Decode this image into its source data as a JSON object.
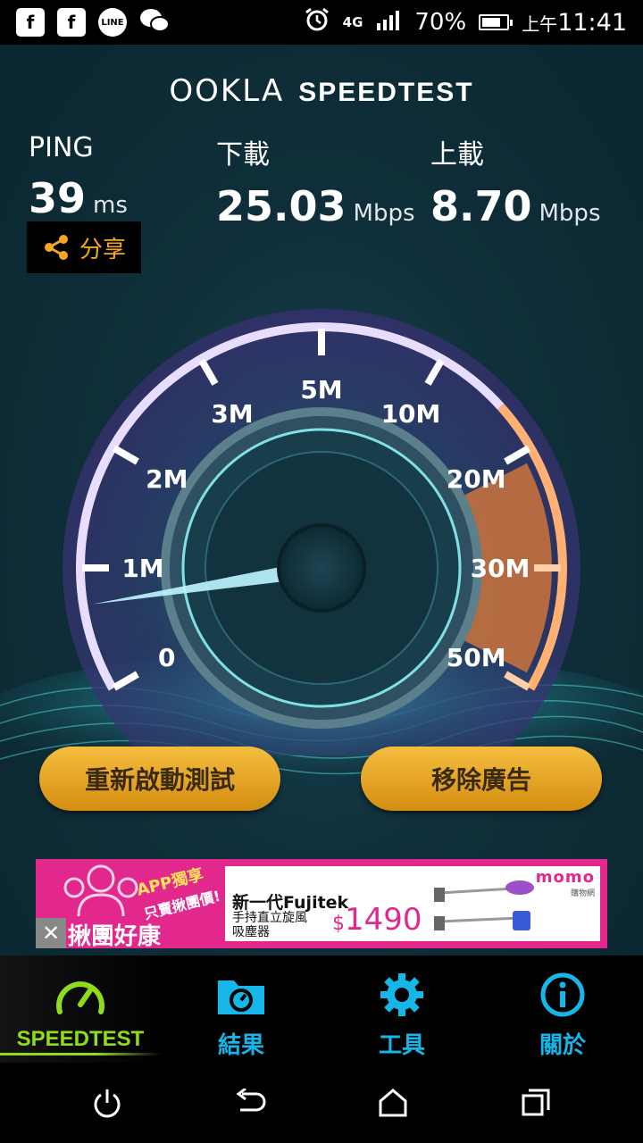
{
  "status_bar": {
    "apps": [
      "facebook-icon",
      "facebook-icon",
      "line-icon",
      "wechat-icon"
    ],
    "line_text": "LINE",
    "network": "4G",
    "battery": "70%",
    "time_prefix": "上午",
    "time": "11:41"
  },
  "header": {
    "brand": "OOKLA",
    "product": "SPEEDTEST"
  },
  "stats": {
    "ping": {
      "label": "PING",
      "value": "39",
      "unit": "ms"
    },
    "download": {
      "label": "下載",
      "value": "25.03",
      "unit": "Mbps"
    },
    "upload": {
      "label": "上載",
      "value": "8.70",
      "unit": "Mbps"
    }
  },
  "share": {
    "label": "分享",
    "icon": "share-icon"
  },
  "gauge": {
    "ticks": [
      "0",
      "1M",
      "2M",
      "3M",
      "5M",
      "10M",
      "20M",
      "30M",
      "50M"
    ],
    "needle_reading": 0.35,
    "colors": {
      "ring": "#c9b6ff",
      "active": "#ff9a3c"
    }
  },
  "buttons": {
    "restart": "重新啟動測試",
    "remove_ads": "移除廣告"
  },
  "ad": {
    "brand": "揪團好康",
    "app_tag": "APP獨享",
    "app_sub": "只賣揪團價!",
    "store": "momo",
    "store_sub": "購物網",
    "title": "新一代Fujitek",
    "desc": "手持直立旋風吸塵器",
    "currency": "$",
    "price": "1490",
    "close": "✕"
  },
  "tabs": [
    {
      "label": "SPEEDTEST",
      "icon": "speedometer-icon",
      "active": true
    },
    {
      "label": "結果",
      "icon": "results-folder-icon",
      "active": false
    },
    {
      "label": "工具",
      "icon": "gear-icon",
      "active": false
    },
    {
      "label": "關於",
      "icon": "info-icon",
      "active": false
    }
  ],
  "accent": "#16b7e8",
  "active_accent": "#8fdc1d"
}
